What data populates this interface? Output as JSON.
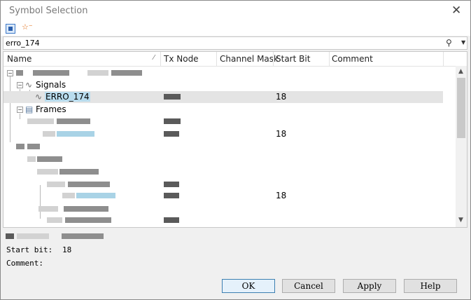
{
  "window": {
    "title": "Symbol Selection",
    "close_glyph": "✕"
  },
  "toolbar": {
    "btn1_icon": "view-icon",
    "btn2_icon": "collapse-icon",
    "btn2_glyph": "☆⁻"
  },
  "search": {
    "value": "erro_174",
    "binoculars_glyph": "⚲",
    "dropdown_glyph": "▼"
  },
  "grid": {
    "columns": [
      "Name",
      "Tx Node",
      "Channel Mask",
      "Start Bit",
      "Comment"
    ],
    "sort_glyph": "⁄",
    "tree": {
      "signals_label": "Signals",
      "signal_label": "ERRO_174",
      "signal_start_bit": "18",
      "frames_label": "Frames",
      "frame_row_start_bit": "18",
      "deep_row_start_bit": "18"
    },
    "scroll_up": "▲",
    "scroll_down": "▼"
  },
  "details": {
    "start_bit_label": "Start bit:",
    "start_bit_value": "18",
    "comment_label": "Comment:"
  },
  "buttons": {
    "ok": "OK",
    "cancel": "Cancel",
    "apply": "Apply",
    "help": "Help"
  }
}
